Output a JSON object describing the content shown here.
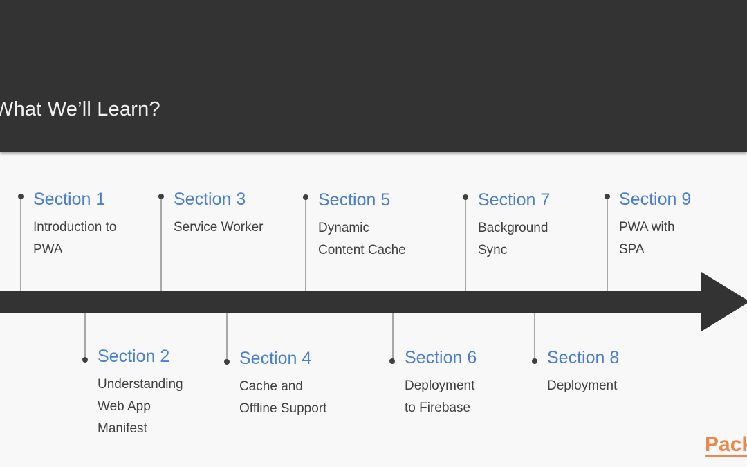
{
  "header": {
    "title": "What We’ll Learn?"
  },
  "colors": {
    "header_bg": "#333333",
    "section_title": "#4a7fd0",
    "section_desc": "#404040",
    "logo": "#e8894e"
  },
  "sections": [
    {
      "title": "Section 1",
      "description": "Introduction to\nPWA",
      "position": "above"
    },
    {
      "title": "Section 2",
      "description": "Understanding\nWeb App\nManifest",
      "position": "below"
    },
    {
      "title": "Section 3",
      "description": "Service Worker",
      "position": "above"
    },
    {
      "title": "Section 4",
      "description": "Cache and\nOffline Support",
      "position": "below"
    },
    {
      "title": "Section 5",
      "description": "Dynamic\nContent Cache",
      "position": "above"
    },
    {
      "title": "Section 6",
      "description": "Deployment\nto Firebase",
      "position": "below"
    },
    {
      "title": "Section 7",
      "description": "Background\nSync",
      "position": "above"
    },
    {
      "title": "Section 8",
      "description": "Deployment",
      "position": "below"
    },
    {
      "title": "Section 9",
      "description": "PWA with\nSPA",
      "position": "above"
    }
  ],
  "logo": {
    "text": "Packt"
  }
}
